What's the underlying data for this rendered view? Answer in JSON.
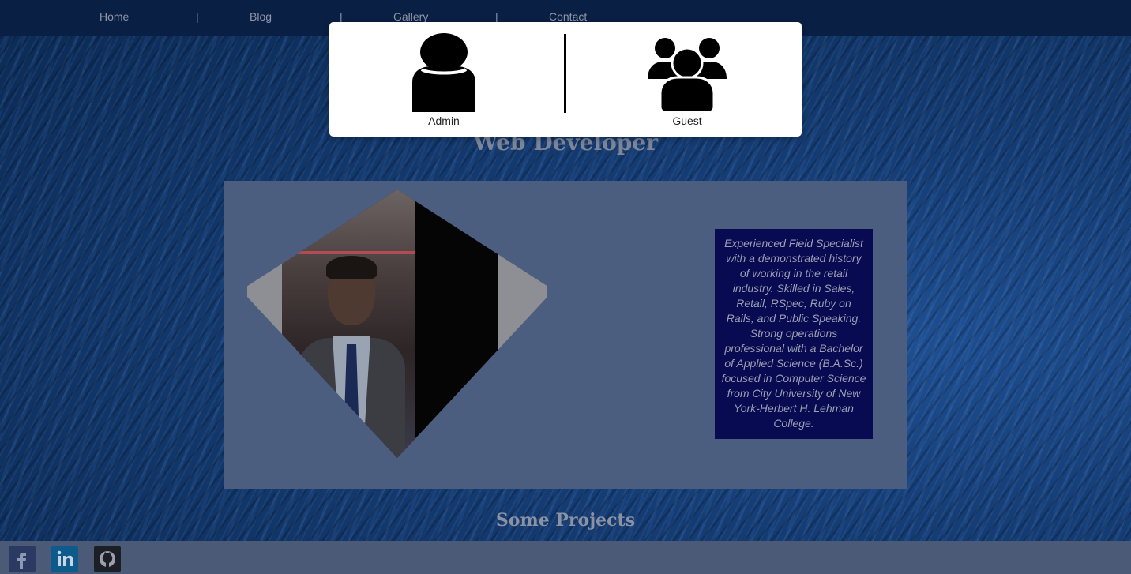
{
  "nav": {
    "items": [
      {
        "label": "Home"
      },
      {
        "label": "Blog"
      },
      {
        "label": "Gallery"
      },
      {
        "label": "Contact"
      }
    ],
    "separator": "|"
  },
  "modal": {
    "admin_label": "Admin",
    "guest_label": "Guest"
  },
  "header": {
    "subtitle": "Web Developer"
  },
  "profile": {
    "bio": "Experienced Field Specialist with a demonstrated history of working in the retail industry. Skilled in Sales, Retail, RSpec, Ruby on Rails, and Public Speaking. Strong operations professional with a Bachelor of Applied Science (B.A.Sc.) focused in Computer Science from City University of New York-Herbert H. Lehman College."
  },
  "projects": {
    "title": "Some Projects"
  },
  "footer": {
    "social": [
      {
        "icon": "facebook-icon",
        "glyph": "f",
        "color": "#3b5998"
      },
      {
        "icon": "linkedin-icon",
        "glyph": "in",
        "color": "#0e76a8"
      },
      {
        "icon": "github-icon",
        "glyph": "",
        "color": "#222222"
      }
    ]
  }
}
